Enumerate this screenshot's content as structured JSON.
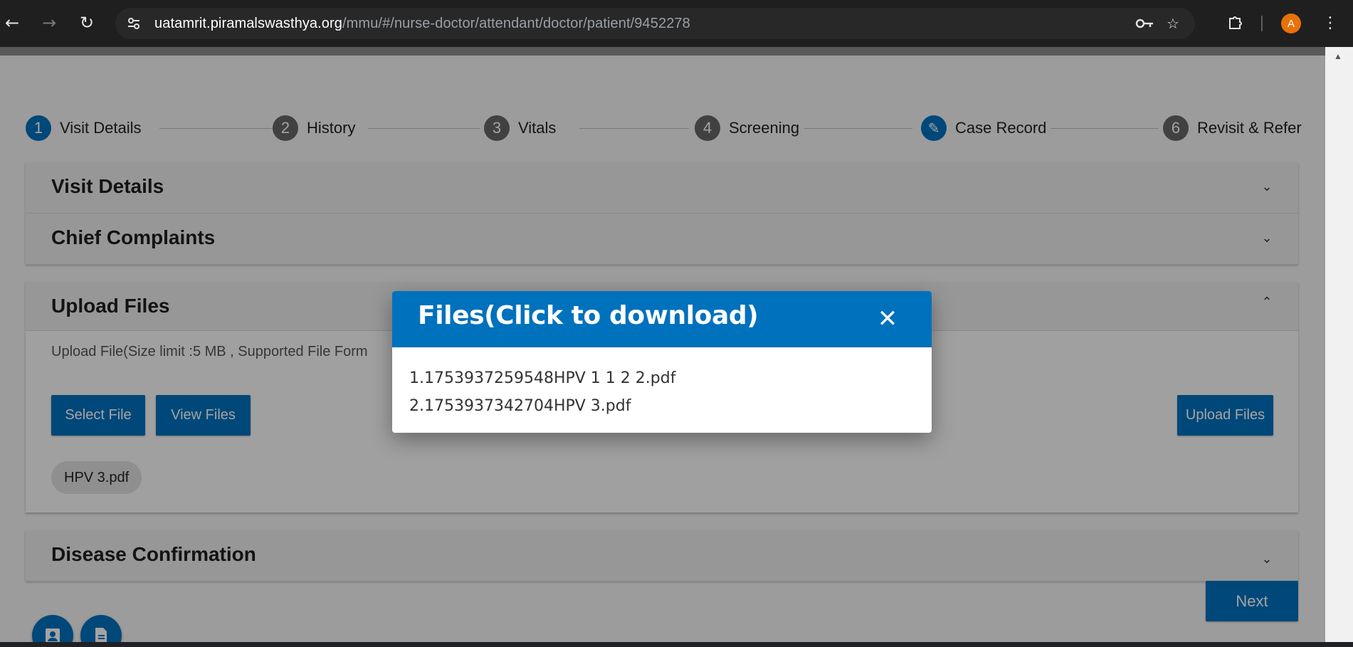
{
  "browser": {
    "url_host": "uatamrit.piramalswasthya.org",
    "url_path": "/mmu/#/nurse-doctor/attendant/doctor/patient/9452278",
    "profile_initial": "A"
  },
  "stepper": {
    "steps": [
      {
        "number": "1",
        "label": "Visit Details"
      },
      {
        "number": "2",
        "label": "History"
      },
      {
        "number": "3",
        "label": "Vitals"
      },
      {
        "number": "4",
        "label": "Screening"
      },
      {
        "number": "✎",
        "label": "Case Record"
      },
      {
        "number": "6",
        "label": "Revisit & Refer"
      }
    ]
  },
  "panels": {
    "visit_details": "Visit Details",
    "chief_complaints": "Chief Complaints",
    "upload_files": "Upload Files",
    "disease_confirmation": "Disease Confirmation"
  },
  "upload": {
    "hint": "Upload File(Size limit :5 MB , Supported File Form",
    "select_file": "Select File",
    "view_files": "View Files",
    "upload_files_button": "Upload Files",
    "chip": "HPV 3.pdf"
  },
  "next_button": "Next",
  "dialog": {
    "title": "Files(Click to download)",
    "files": [
      "1.1753937259548HPV 1 1 2 2.pdf",
      "2.1753937342704HPV 3.pdf"
    ]
  },
  "colors": {
    "primary": "#0071bd",
    "chrome": "#1f1f1f"
  },
  "icons": {
    "back": "arrow-left-icon",
    "forward": "arrow-right-icon",
    "reload": "reload-icon",
    "site_info": "tune-icon",
    "password": "key-icon",
    "bookmark": "star-icon",
    "extensions": "puzzle-icon",
    "menu": "kebab-menu-icon",
    "close": "close-icon"
  }
}
